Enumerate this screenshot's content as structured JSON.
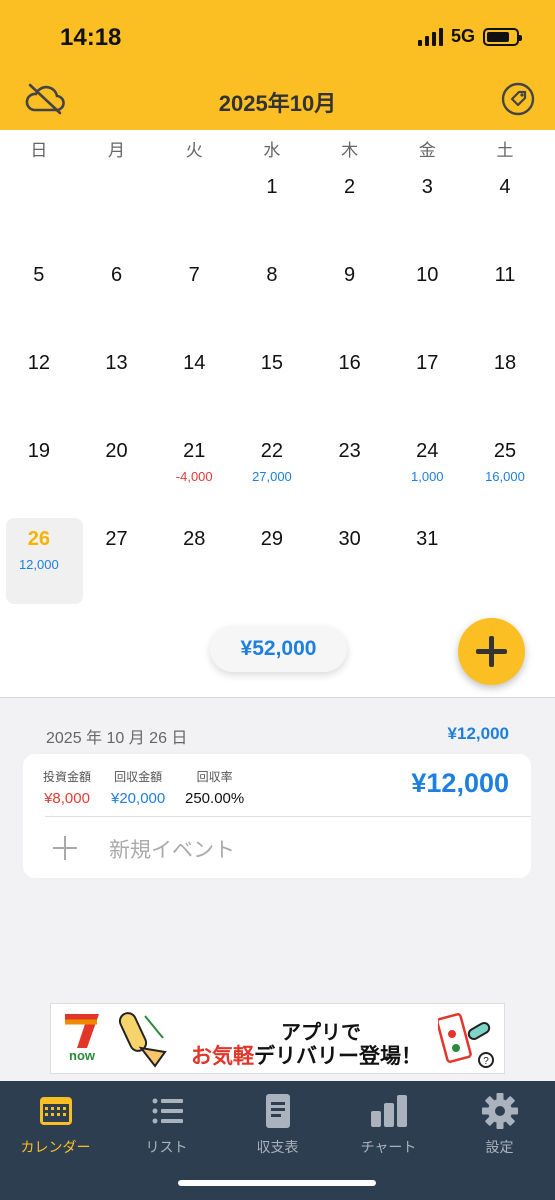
{
  "status": {
    "time": "14:18",
    "network": "5G"
  },
  "header": {
    "title": "2025年10月",
    "left_icon": "cloud-off-icon",
    "right_icon": "tag-icon"
  },
  "calendar": {
    "weekdays": [
      "日",
      "月",
      "火",
      "水",
      "木",
      "金",
      "土"
    ],
    "weeks": [
      [
        {
          "day": ""
        },
        {
          "day": ""
        },
        {
          "day": ""
        },
        {
          "day": "1"
        },
        {
          "day": "2"
        },
        {
          "day": "3"
        },
        {
          "day": "4"
        }
      ],
      [
        {
          "day": "5"
        },
        {
          "day": "6"
        },
        {
          "day": "7"
        },
        {
          "day": "8"
        },
        {
          "day": "9"
        },
        {
          "day": "10"
        },
        {
          "day": "11"
        }
      ],
      [
        {
          "day": "12"
        },
        {
          "day": "13"
        },
        {
          "day": "14"
        },
        {
          "day": "15"
        },
        {
          "day": "16"
        },
        {
          "day": "17"
        },
        {
          "day": "18"
        }
      ],
      [
        {
          "day": "19"
        },
        {
          "day": "20"
        },
        {
          "day": "21",
          "amount": "-4,000",
          "sign": "neg"
        },
        {
          "day": "22",
          "amount": "27,000",
          "sign": "pos"
        },
        {
          "day": "23"
        },
        {
          "day": "24",
          "amount": "1,000",
          "sign": "pos"
        },
        {
          "day": "25",
          "amount": "16,000",
          "sign": "pos"
        }
      ],
      [
        {
          "day": "26",
          "amount": "12,000",
          "sign": "pos",
          "today": true
        },
        {
          "day": "27"
        },
        {
          "day": "28"
        },
        {
          "day": "29"
        },
        {
          "day": "30"
        },
        {
          "day": "31"
        },
        {
          "day": ""
        }
      ]
    ],
    "month_total": "¥52,000"
  },
  "detail": {
    "date": "2025 年 10 月 26 日",
    "total": "¥12,000",
    "invest_label": "投資金額",
    "invest_value": "¥8,000",
    "return_label": "回収金額",
    "return_value": "¥20,000",
    "rate_label": "回収率",
    "rate_value": "250.00%",
    "amount": "¥12,000",
    "new_event": "新規イベント"
  },
  "ad": {
    "line1": "アプリで",
    "line2_highlight": "お気軽",
    "line2_rest": "デリバリー登場！",
    "logo_text": "now"
  },
  "tabs": [
    {
      "label": "カレンダー",
      "icon": "calendar-icon",
      "active": true
    },
    {
      "label": "リスト",
      "icon": "list-icon"
    },
    {
      "label": "収支表",
      "icon": "document-icon"
    },
    {
      "label": "チャート",
      "icon": "bar-chart-icon"
    },
    {
      "label": "設定",
      "icon": "gear-icon"
    }
  ],
  "colors": {
    "accent": "#fbbf24",
    "positive": "#1d7fe0",
    "negative": "#e53935",
    "tabbar": "#2e3e51"
  }
}
